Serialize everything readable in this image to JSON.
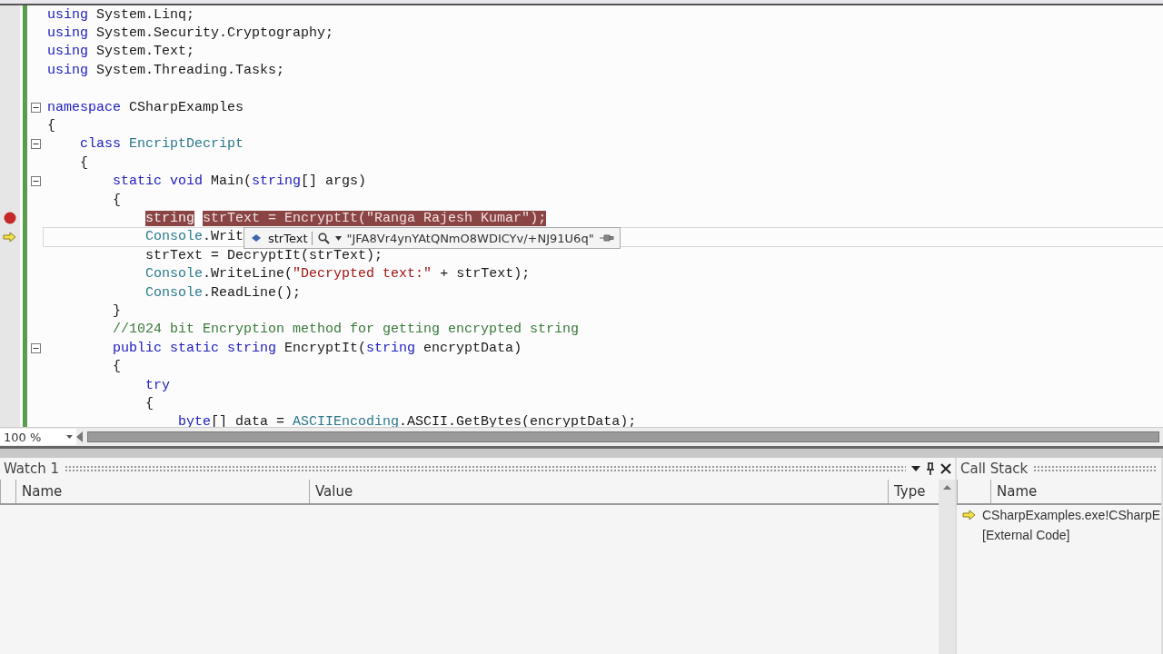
{
  "editor": {
    "zoom": "100 %",
    "lines": [
      {
        "kind": "code",
        "segments": [
          {
            "kind": "kw",
            "text": "using"
          },
          {
            "kind": "plain",
            "text": " System.Linq;"
          }
        ]
      },
      {
        "kind": "code",
        "segments": [
          {
            "kind": "kw",
            "text": "using"
          },
          {
            "kind": "plain",
            "text": " System.Security.Cryptography;"
          }
        ]
      },
      {
        "kind": "code",
        "segments": [
          {
            "kind": "kw",
            "text": "using"
          },
          {
            "kind": "plain",
            "text": " System.Text;"
          }
        ]
      },
      {
        "kind": "code",
        "segments": [
          {
            "kind": "kw",
            "text": "using"
          },
          {
            "kind": "plain",
            "text": " System.Threading.Tasks;"
          }
        ]
      },
      {
        "kind": "blank"
      },
      {
        "kind": "code",
        "fold": true,
        "segments": [
          {
            "kind": "kw",
            "text": "namespace"
          },
          {
            "kind": "plain",
            "text": " CSharpExamples"
          }
        ]
      },
      {
        "kind": "code",
        "segments": [
          {
            "kind": "plain",
            "text": "{"
          }
        ]
      },
      {
        "kind": "code",
        "fold": true,
        "segments": [
          {
            "kind": "kw",
            "text": "    class"
          },
          {
            "kind": "type",
            "text": " EncriptDecript"
          }
        ]
      },
      {
        "kind": "code",
        "segments": [
          {
            "kind": "plain",
            "text": "    {"
          }
        ]
      },
      {
        "kind": "code",
        "fold": true,
        "segments": [
          {
            "kind": "kw",
            "text": "        static void"
          },
          {
            "kind": "plain",
            "text": " Main("
          },
          {
            "kind": "kw",
            "text": "string"
          },
          {
            "kind": "plain",
            "text": "[] args)"
          }
        ]
      },
      {
        "kind": "code",
        "segments": [
          {
            "kind": "plain",
            "text": "        {"
          }
        ]
      },
      {
        "kind": "code",
        "breakpoint": true,
        "segments": [
          {
            "kind": "kw",
            "text": "            string"
          },
          {
            "kind": "plain",
            "text": " strText = EncryptIt("
          },
          {
            "kind": "str",
            "text": "\"Ranga Rajesh Kumar\""
          },
          {
            "kind": "plain",
            "text": ");"
          }
        ]
      },
      {
        "kind": "code",
        "current": true,
        "segments": [
          {
            "kind": "type",
            "text": "            Console"
          },
          {
            "kind": "plain",
            "text": ".Writ"
          }
        ]
      },
      {
        "kind": "code",
        "segments": [
          {
            "kind": "plain",
            "text": "            strText = DecryptIt(strText);"
          }
        ]
      },
      {
        "kind": "code",
        "segments": [
          {
            "kind": "type",
            "text": "            Console"
          },
          {
            "kind": "plain",
            "text": ".WriteLine("
          },
          {
            "kind": "str",
            "text": "\"Decrypted text:\""
          },
          {
            "kind": "plain",
            "text": " + strText);"
          }
        ]
      },
      {
        "kind": "code",
        "segments": [
          {
            "kind": "type",
            "text": "            Console"
          },
          {
            "kind": "plain",
            "text": ".ReadLine();"
          }
        ]
      },
      {
        "kind": "code",
        "segments": [
          {
            "kind": "plain",
            "text": "        }"
          }
        ]
      },
      {
        "kind": "code",
        "segments": [
          {
            "kind": "comment",
            "text": "        //1024 bit Encryption method for getting encrypted string"
          }
        ]
      },
      {
        "kind": "code",
        "fold": true,
        "segments": [
          {
            "kind": "kw",
            "text": "        public static string"
          },
          {
            "kind": "plain",
            "text": " EncryptIt("
          },
          {
            "kind": "kw",
            "text": "string"
          },
          {
            "kind": "plain",
            "text": " encryptData)"
          }
        ]
      },
      {
        "kind": "code",
        "segments": [
          {
            "kind": "plain",
            "text": "        {"
          }
        ]
      },
      {
        "kind": "code",
        "segments": [
          {
            "kind": "kw",
            "text": "            try"
          }
        ]
      },
      {
        "kind": "code",
        "segments": [
          {
            "kind": "plain",
            "text": "            {"
          }
        ]
      },
      {
        "kind": "code",
        "segments": [
          {
            "kind": "kw",
            "text": "                byte"
          },
          {
            "kind": "plain",
            "text": "[] data = "
          },
          {
            "kind": "type",
            "text": "ASCIIEncoding"
          },
          {
            "kind": "plain",
            "text": ".ASCII.GetBytes(encryptData);"
          }
        ]
      }
    ]
  },
  "datatip": {
    "name": "strText",
    "value": "\"JFA8Vr4ynYAtQNmO8WDICYv/+NJ91U6q\""
  },
  "watch": {
    "title": "Watch 1",
    "columns": [
      "Name",
      "Value",
      "Type"
    ]
  },
  "call_stack": {
    "title": "Call Stack",
    "columns": [
      "Name"
    ],
    "rows": [
      {
        "text": "CSharpExamples.exe!CSharpE",
        "current": true
      },
      {
        "text": "[External Code]",
        "current": false
      }
    ]
  }
}
